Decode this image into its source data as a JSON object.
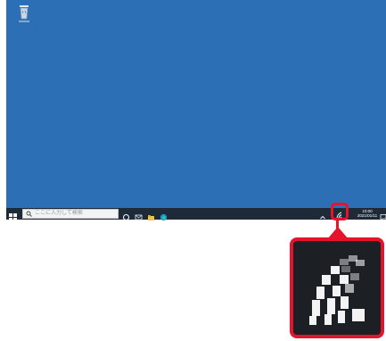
{
  "desktop": {
    "background_color": "#2d6fb5",
    "icons": [
      {
        "name": "Recycle Bin",
        "icon": "recycle-bin-icon"
      }
    ]
  },
  "taskbar": {
    "background_color": "#1f2a38",
    "start_icon": "windows-start-icon",
    "search_placeholder": "ここに入力して検索",
    "pinned_icons": [
      "task-view-icon",
      "mail-icon",
      "file-explorer-icon",
      "edge-icon"
    ],
    "tray": {
      "overflow_icon": "chevron-up-icon",
      "network_icon": "wifi-icon",
      "time": "10:00",
      "date": "2021/01/11",
      "notification_icon": "action-center-icon"
    }
  },
  "callout": {
    "highlight_color": "#e4142d",
    "zoomed_icon": "wifi-icon"
  }
}
